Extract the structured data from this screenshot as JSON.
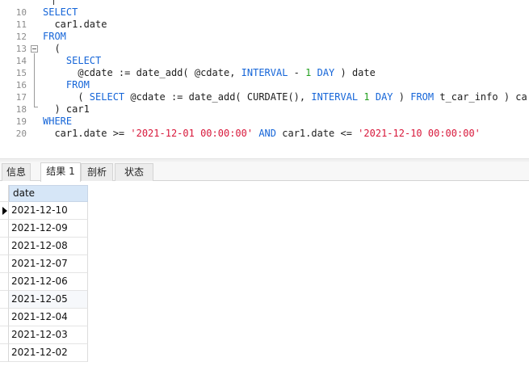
{
  "editor": {
    "line_numbers": [
      "10",
      "11",
      "12",
      "13",
      "14",
      "15",
      "16",
      "17",
      "18",
      "19",
      "20"
    ],
    "lines": [
      [
        {
          "t": "SELECT",
          "c": "kw"
        }
      ],
      [
        {
          "t": "  car1.date",
          "c": ""
        }
      ],
      [
        {
          "t": "FROM",
          "c": "kw"
        }
      ],
      [
        {
          "t": "  (",
          "c": ""
        }
      ],
      [
        {
          "t": "    ",
          "c": ""
        },
        {
          "t": "SELECT",
          "c": "kw"
        }
      ],
      [
        {
          "t": "      @cdate := date_add( @cdate, ",
          "c": ""
        },
        {
          "t": "INTERVAL",
          "c": "kw"
        },
        {
          "t": " - ",
          "c": ""
        },
        {
          "t": "1",
          "c": "num"
        },
        {
          "t": " ",
          "c": ""
        },
        {
          "t": "DAY",
          "c": "kw"
        },
        {
          "t": " ) date",
          "c": ""
        }
      ],
      [
        {
          "t": "    ",
          "c": ""
        },
        {
          "t": "FROM",
          "c": "kw"
        }
      ],
      [
        {
          "t": "      ( ",
          "c": ""
        },
        {
          "t": "SELECT",
          "c": "kw"
        },
        {
          "t": " @cdate := date_add( CURDATE(), ",
          "c": ""
        },
        {
          "t": "INTERVAL",
          "c": "kw"
        },
        {
          "t": " ",
          "c": ""
        },
        {
          "t": "1",
          "c": "num"
        },
        {
          "t": " ",
          "c": ""
        },
        {
          "t": "DAY",
          "c": "kw"
        },
        {
          "t": " ) ",
          "c": ""
        },
        {
          "t": "FROM",
          "c": "kw"
        },
        {
          "t": " t_car_info ) car",
          "c": ""
        }
      ],
      [
        {
          "t": "  ) car1",
          "c": ""
        }
      ],
      [
        {
          "t": "WHERE",
          "c": "kw"
        }
      ],
      [
        {
          "t": "  car1.date >= ",
          "c": ""
        },
        {
          "t": "'2021-12-01 00:00:00'",
          "c": "str"
        },
        {
          "t": " ",
          "c": ""
        },
        {
          "t": "AND",
          "c": "kw"
        },
        {
          "t": " car1.date <= ",
          "c": ""
        },
        {
          "t": "'2021-12-10 00:00:00'",
          "c": "str"
        }
      ]
    ]
  },
  "tabs": {
    "info": "信息",
    "result": "结果 1",
    "profile": "剖析",
    "status": "状态"
  },
  "result": {
    "column": "date",
    "rows": [
      "2021-12-10",
      "2021-12-09",
      "2021-12-08",
      "2021-12-07",
      "2021-12-06",
      "2021-12-05",
      "2021-12-04",
      "2021-12-03",
      "2021-12-02"
    ]
  }
}
